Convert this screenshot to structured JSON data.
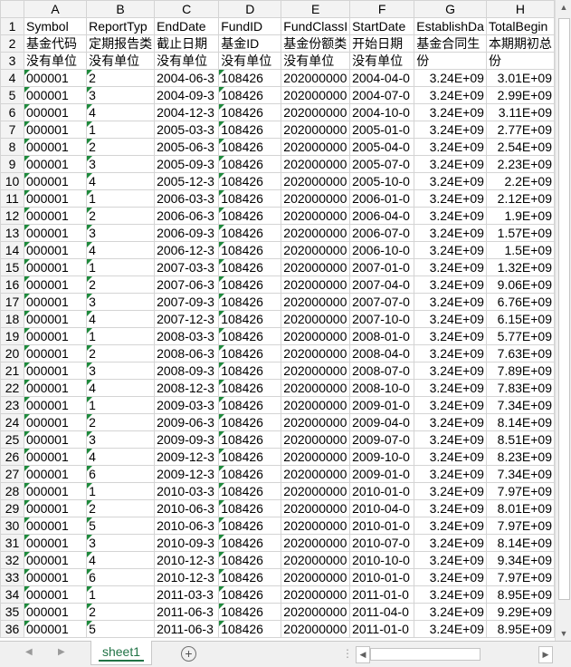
{
  "columns": [
    "A",
    "B",
    "C",
    "D",
    "E",
    "F",
    "G",
    "H"
  ],
  "rows": [
    {
      "n": "1",
      "cells": [
        "Symbol",
        "ReportTyp",
        "EndDate",
        "FundID",
        "FundClassI",
        "StartDate",
        "EstablishDa",
        "TotalBegin"
      ]
    },
    {
      "n": "2",
      "cells": [
        "基金代码",
        "定期报告类",
        "截止日期",
        "基金ID",
        "基金份额类",
        "开始日期",
        "基金合同生",
        "本期期初总"
      ]
    },
    {
      "n": "3",
      "cells": [
        "没有单位",
        "没有单位",
        "没有单位",
        "没有单位",
        "没有单位",
        "没有单位",
        "份",
        "份"
      ]
    },
    {
      "n": "4",
      "cells": [
        "000001",
        "2",
        "2004-06-3",
        "108426",
        "202000000",
        "2004-04-0",
        "3.24E+09",
        "3.01E+09"
      ]
    },
    {
      "n": "5",
      "cells": [
        "000001",
        "3",
        "2004-09-3",
        "108426",
        "202000000",
        "2004-07-0",
        "3.24E+09",
        "2.99E+09"
      ]
    },
    {
      "n": "6",
      "cells": [
        "000001",
        "4",
        "2004-12-3",
        "108426",
        "202000000",
        "2004-10-0",
        "3.24E+09",
        "3.11E+09"
      ]
    },
    {
      "n": "7",
      "cells": [
        "000001",
        "1",
        "2005-03-3",
        "108426",
        "202000000",
        "2005-01-0",
        "3.24E+09",
        "2.77E+09"
      ]
    },
    {
      "n": "8",
      "cells": [
        "000001",
        "2",
        "2005-06-3",
        "108426",
        "202000000",
        "2005-04-0",
        "3.24E+09",
        "2.54E+09"
      ]
    },
    {
      "n": "9",
      "cells": [
        "000001",
        "3",
        "2005-09-3",
        "108426",
        "202000000",
        "2005-07-0",
        "3.24E+09",
        "2.23E+09"
      ]
    },
    {
      "n": "10",
      "cells": [
        "000001",
        "4",
        "2005-12-3",
        "108426",
        "202000000",
        "2005-10-0",
        "3.24E+09",
        "2.2E+09"
      ]
    },
    {
      "n": "11",
      "cells": [
        "000001",
        "1",
        "2006-03-3",
        "108426",
        "202000000",
        "2006-01-0",
        "3.24E+09",
        "2.12E+09"
      ]
    },
    {
      "n": "12",
      "cells": [
        "000001",
        "2",
        "2006-06-3",
        "108426",
        "202000000",
        "2006-04-0",
        "3.24E+09",
        "1.9E+09"
      ]
    },
    {
      "n": "13",
      "cells": [
        "000001",
        "3",
        "2006-09-3",
        "108426",
        "202000000",
        "2006-07-0",
        "3.24E+09",
        "1.57E+09"
      ]
    },
    {
      "n": "14",
      "cells": [
        "000001",
        "4",
        "2006-12-3",
        "108426",
        "202000000",
        "2006-10-0",
        "3.24E+09",
        "1.5E+09"
      ]
    },
    {
      "n": "15",
      "cells": [
        "000001",
        "1",
        "2007-03-3",
        "108426",
        "202000000",
        "2007-01-0",
        "3.24E+09",
        "1.32E+09"
      ]
    },
    {
      "n": "16",
      "cells": [
        "000001",
        "2",
        "2007-06-3",
        "108426",
        "202000000",
        "2007-04-0",
        "3.24E+09",
        "9.06E+09"
      ]
    },
    {
      "n": "17",
      "cells": [
        "000001",
        "3",
        "2007-09-3",
        "108426",
        "202000000",
        "2007-07-0",
        "3.24E+09",
        "6.76E+09"
      ]
    },
    {
      "n": "18",
      "cells": [
        "000001",
        "4",
        "2007-12-3",
        "108426",
        "202000000",
        "2007-10-0",
        "3.24E+09",
        "6.15E+09"
      ]
    },
    {
      "n": "19",
      "cells": [
        "000001",
        "1",
        "2008-03-3",
        "108426",
        "202000000",
        "2008-01-0",
        "3.24E+09",
        "5.77E+09"
      ]
    },
    {
      "n": "20",
      "cells": [
        "000001",
        "2",
        "2008-06-3",
        "108426",
        "202000000",
        "2008-04-0",
        "3.24E+09",
        "7.63E+09"
      ]
    },
    {
      "n": "21",
      "cells": [
        "000001",
        "3",
        "2008-09-3",
        "108426",
        "202000000",
        "2008-07-0",
        "3.24E+09",
        "7.89E+09"
      ]
    },
    {
      "n": "22",
      "cells": [
        "000001",
        "4",
        "2008-12-3",
        "108426",
        "202000000",
        "2008-10-0",
        "3.24E+09",
        "7.83E+09"
      ]
    },
    {
      "n": "23",
      "cells": [
        "000001",
        "1",
        "2009-03-3",
        "108426",
        "202000000",
        "2009-01-0",
        "3.24E+09",
        "7.34E+09"
      ]
    },
    {
      "n": "24",
      "cells": [
        "000001",
        "2",
        "2009-06-3",
        "108426",
        "202000000",
        "2009-04-0",
        "3.24E+09",
        "8.14E+09"
      ]
    },
    {
      "n": "25",
      "cells": [
        "000001",
        "3",
        "2009-09-3",
        "108426",
        "202000000",
        "2009-07-0",
        "3.24E+09",
        "8.51E+09"
      ]
    },
    {
      "n": "26",
      "cells": [
        "000001",
        "4",
        "2009-12-3",
        "108426",
        "202000000",
        "2009-10-0",
        "3.24E+09",
        "8.23E+09"
      ]
    },
    {
      "n": "27",
      "cells": [
        "000001",
        "6",
        "2009-12-3",
        "108426",
        "202000000",
        "2009-01-0",
        "3.24E+09",
        "7.34E+09"
      ]
    },
    {
      "n": "28",
      "cells": [
        "000001",
        "1",
        "2010-03-3",
        "108426",
        "202000000",
        "2010-01-0",
        "3.24E+09",
        "7.97E+09"
      ]
    },
    {
      "n": "29",
      "cells": [
        "000001",
        "2",
        "2010-06-3",
        "108426",
        "202000000",
        "2010-04-0",
        "3.24E+09",
        "8.01E+09"
      ]
    },
    {
      "n": "30",
      "cells": [
        "000001",
        "5",
        "2010-06-3",
        "108426",
        "202000000",
        "2010-01-0",
        "3.24E+09",
        "7.97E+09"
      ]
    },
    {
      "n": "31",
      "cells": [
        "000001",
        "3",
        "2010-09-3",
        "108426",
        "202000000",
        "2010-07-0",
        "3.24E+09",
        "8.14E+09"
      ]
    },
    {
      "n": "32",
      "cells": [
        "000001",
        "4",
        "2010-12-3",
        "108426",
        "202000000",
        "2010-10-0",
        "3.24E+09",
        "9.34E+09"
      ]
    },
    {
      "n": "33",
      "cells": [
        "000001",
        "6",
        "2010-12-3",
        "108426",
        "202000000",
        "2010-01-0",
        "3.24E+09",
        "7.97E+09"
      ]
    },
    {
      "n": "34",
      "cells": [
        "000001",
        "1",
        "2011-03-3",
        "108426",
        "202000000",
        "2011-01-0",
        "3.24E+09",
        "8.95E+09"
      ]
    },
    {
      "n": "35",
      "cells": [
        "000001",
        "2",
        "2011-06-3",
        "108426",
        "202000000",
        "2011-04-0",
        "3.24E+09",
        "9.29E+09"
      ]
    },
    {
      "n": "36",
      "cells": [
        "000001",
        "5",
        "2011-06-3",
        "108426",
        "202000000",
        "2011-01-0",
        "3.24E+09",
        "8.95E+09"
      ]
    }
  ],
  "tabs": {
    "active_sheet": "sheet1"
  },
  "icons": {
    "add_sheet": "plus-circle-icon",
    "prev": "triangle-left-icon",
    "next": "triangle-right-icon"
  },
  "colors": {
    "accent": "#217346",
    "flag": "#1e8a3c"
  }
}
